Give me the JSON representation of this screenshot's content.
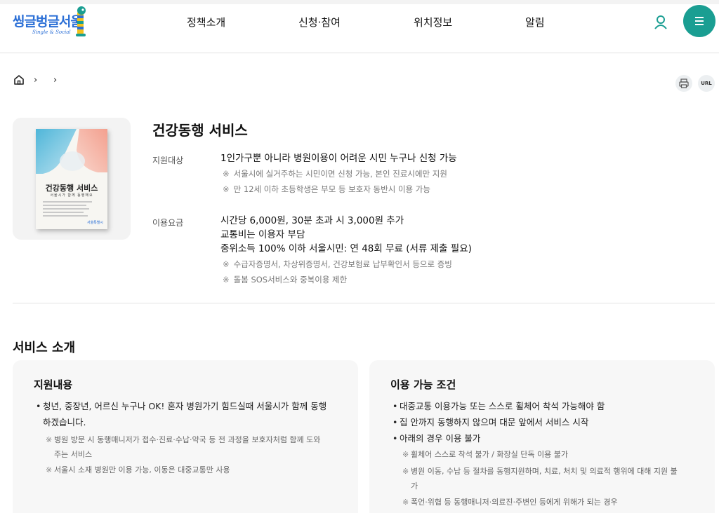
{
  "header": {
    "logo_text": "씽글벙글서울",
    "logo_sub": "Single & Social",
    "nav": [
      "정책소개",
      "신청·참여",
      "위치정보",
      "알림"
    ]
  },
  "breadcrumb": {
    "separators": [
      "›",
      "›"
    ]
  },
  "utils": {
    "url_label": "URL"
  },
  "thumbnail": {
    "poster_title": "건강동행 서비스",
    "poster_subtitle": "서울시가 함께 동행해요",
    "poster_logo": "서울특별시"
  },
  "service": {
    "title": "건강동행 서비스",
    "target": {
      "label": "지원대상",
      "main": "1인가구뿐 아니라 병원이용이 어려운 시민 누구나 신청 가능",
      "notes": [
        "서울시에 실거주하는 시민이면 신청 가능, 본인 진료시에만 지원",
        "만 12세 이하 초등학생은 부모 등 보호자 동반시 이용 가능"
      ]
    },
    "fee": {
      "label": "이용요금",
      "lines": [
        "시간당 6,000원, 30분 초과 시 3,000원 추가",
        "교통비는 이용자 부담",
        "중위소득 100% 이하 서울시민: 연 48회 무료 (서류 제출 필요)"
      ],
      "notes": [
        "수급자증명서, 차상위증명서, 건강보험료 납부확인서 등으로 증빙",
        "돌봄 SOS서비스와 중복이용 제한"
      ]
    }
  },
  "intro": {
    "title": "서비스 소개",
    "left": {
      "title": "지원내용",
      "bullets": [
        "청년, 중장년, 어르신 누구나 OK! 혼자 병원가기 힘드실때 서울시가 함께 동행 하겠습니다."
      ],
      "notes": [
        "병원 방문 시 동행매니저가 접수·진료·수납·약국 등 전 과정을 보호자처럼 함께 도와주는 서비스",
        "서울시 소재 병원만 이용 가능, 이동은 대중교통만 사용"
      ]
    },
    "right": {
      "title": "이용 가능 조건",
      "bullets": [
        "대중교통 이용가능 또는 스스로 휠체어 착석 가능해야 함",
        "집 안까지 동행하지 않으며 대문 앞에서 서비스 시작",
        "아래의 경우 이용 불가"
      ],
      "notes": [
        "휠체어 스스로 착석 불가 / 화장실 단독 이용 불가",
        "병원 이동, 수납 등 절차를 동행지원하며, 치료, 처치 및 의료적 행위에 대해 지원 불가",
        "폭언·위협 등 동행매니저·의료진·주변인 등에게 위해가 되는 경우"
      ]
    }
  },
  "colors": {
    "accent": "#1a9e92",
    "logo_blue": "#2b6fd6"
  }
}
